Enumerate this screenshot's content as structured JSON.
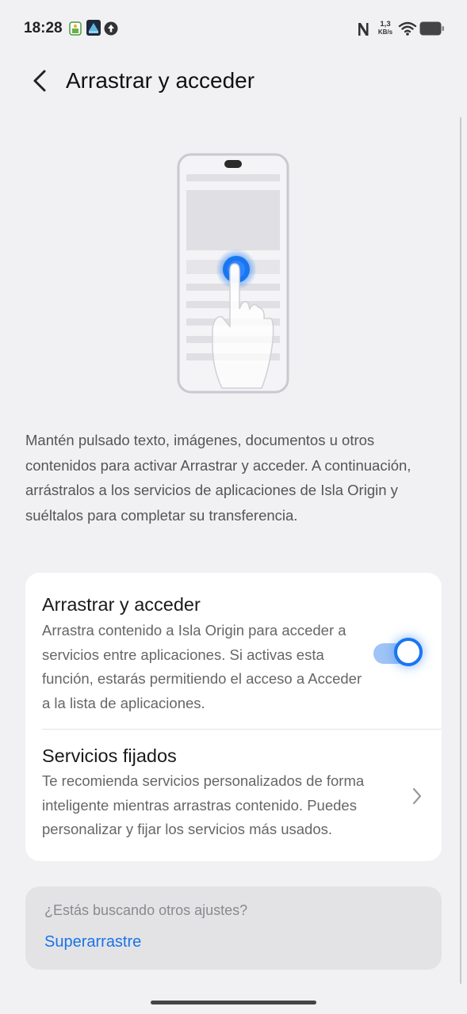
{
  "status_bar": {
    "time": "18:28",
    "net_speed_value": "1,3",
    "net_speed_unit": "KB/s",
    "icons": [
      "gallery-app-icon",
      "app-notification-icon",
      "upload-icon",
      "nfc-icon",
      "wifi-icon",
      "battery-icon"
    ]
  },
  "header": {
    "title": "Arrastrar y acceder",
    "back_icon": "back-arrow-icon"
  },
  "description": "Mantén pulsado texto, imágenes, documentos u otros contenidos para activar Arrastrar y acceder. A continuación, arrástralos a los servicios de aplicaciones de Isla Origin y suéltalos para completar su transferencia.",
  "settings": {
    "drag_access": {
      "title": "Arrastrar y acceder",
      "description": "Arrastra contenido a Isla Origin para acceder a servicios entre aplicaciones. Si activas esta función, estarás permitiendo el acceso a Acceder a la lista de aplicaciones.",
      "enabled": true
    },
    "pinned_services": {
      "title": "Servicios fijados",
      "description": "Te recomienda servicios personalizados de forma inteligente mientras arrastras contenido. Puedes personalizar y fijar los servicios más usados."
    }
  },
  "search": {
    "question": "¿Estás buscando otros ajustes?",
    "link": "Superarrastre"
  },
  "colors": {
    "accent": "#1976f0",
    "link": "#1a73e8",
    "background": "#f1f1f3"
  }
}
